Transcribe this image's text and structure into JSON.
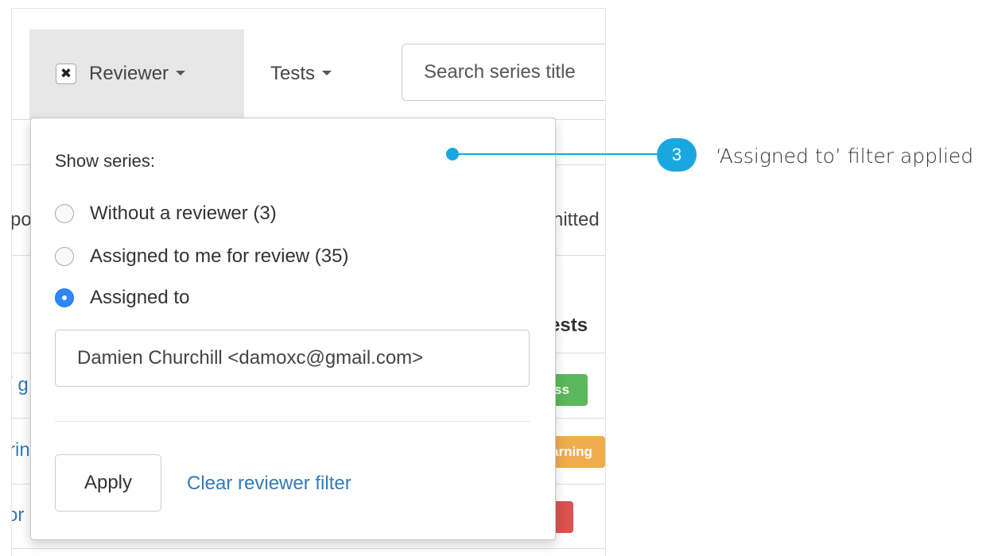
{
  "toolbar": {
    "reviewer_label": "Reviewer",
    "clear_filter_symbol": "✖",
    "tests_label": "Tests",
    "search_text": "Search series title"
  },
  "background_fragments": {
    "left_row_1": "po",
    "right_row_1": "nitted",
    "right_header": "ests",
    "left_row_2": "/ g",
    "left_row_3": "rin",
    "left_row_4": "or",
    "tag_green": "ss",
    "tag_orange": "arning",
    "tag_red": ""
  },
  "dropdown": {
    "heading": "Show series:",
    "options": [
      {
        "label": "Without a reviewer (3)",
        "checked": false
      },
      {
        "label": "Assigned to me for review (35)",
        "checked": false
      },
      {
        "label": "Assigned to",
        "checked": true
      }
    ],
    "assignee_value": "Damien Churchill <damoxc@gmail.com>",
    "apply_label": "Apply",
    "clear_label": "Clear reviewer filter"
  },
  "annotation": {
    "number": "3",
    "text": "‘Assigned to’ filter applied",
    "color": "#1aa7e0"
  },
  "colors": {
    "link": "#337ab7",
    "radio_checked": "#2f86f6",
    "tag_green": "#5cb85c",
    "tag_orange": "#f0ad4e",
    "tag_red": "#d9534f"
  }
}
